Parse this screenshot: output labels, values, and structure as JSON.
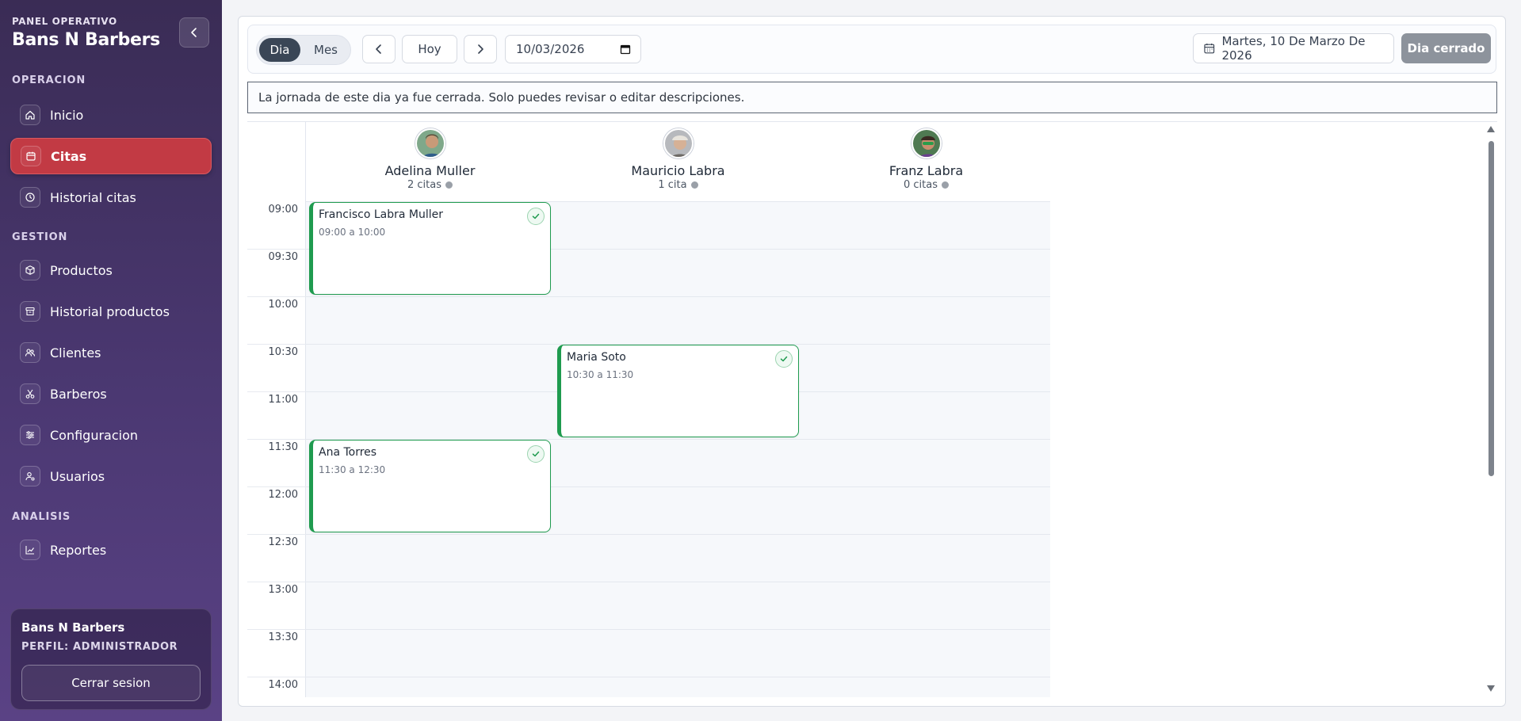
{
  "sidebar": {
    "kicker": "PANEL OPERATIVO",
    "title": "Bans N Barbers",
    "sections": [
      {
        "label": "OPERACION"
      },
      {
        "label": "GESTION"
      },
      {
        "label": "ANALISIS"
      }
    ],
    "items": [
      {
        "label": "Inicio",
        "icon": "home-icon"
      },
      {
        "label": "Citas",
        "icon": "calendar-icon",
        "active": true
      },
      {
        "label": "Historial citas",
        "icon": "clock-icon"
      },
      {
        "label": "Productos",
        "icon": "box-icon"
      },
      {
        "label": "Historial productos",
        "icon": "archive-icon"
      },
      {
        "label": "Clientes",
        "icon": "users-icon"
      },
      {
        "label": "Barberos",
        "icon": "scissors-icon"
      },
      {
        "label": "Configuracion",
        "icon": "sliders-icon"
      },
      {
        "label": "Usuarios",
        "icon": "user-cog-icon"
      },
      {
        "label": "Reportes",
        "icon": "chart-icon"
      }
    ],
    "profile": {
      "name": "Bans N Barbers",
      "role": "PERFIL: ADMINISTRADOR",
      "logout": "Cerrar sesion"
    }
  },
  "toolbar": {
    "view_day": "Dia",
    "view_month": "Mes",
    "today": "Hoy",
    "date_value": "10/03/2026",
    "date_label": "Martes, 10 De Marzo De 2026",
    "closed_badge": "Dia cerrado"
  },
  "notice": "La jornada de este dia ya fue cerrada. Solo puedes revisar o editar descripciones.",
  "times": [
    "09:00",
    "09:30",
    "10:00",
    "10:30",
    "11:00",
    "11:30",
    "12:00",
    "12:30",
    "13:00",
    "13:30",
    "14:00"
  ],
  "staff": [
    {
      "name": "Adelina Muller",
      "count": "2 citas"
    },
    {
      "name": "Mauricio Labra",
      "count": "1 cita"
    },
    {
      "name": "Franz Labra",
      "count": "0 citas"
    }
  ],
  "appointments": [
    {
      "client": "Francisco Labra Muller",
      "range": "09:00 a 10:00"
    },
    {
      "client": "Maria Soto",
      "range": "10:30 a 11:30"
    },
    {
      "client": "Ana Torres",
      "range": "11:30 a 12:30"
    }
  ],
  "colors": {
    "accent_active": "#c23a44",
    "appointment_border": "#1f9b4f",
    "sidebar_bg": "#3a2c55"
  }
}
